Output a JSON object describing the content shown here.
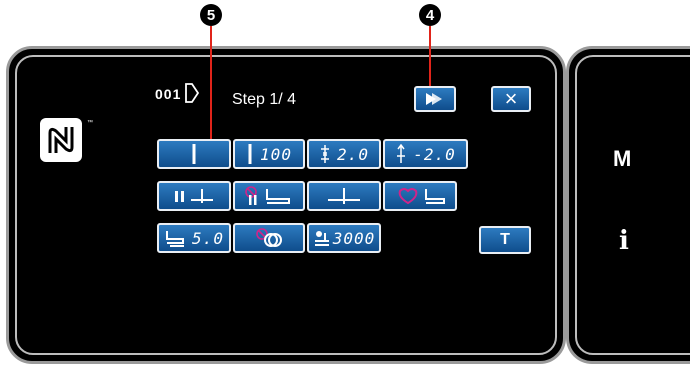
{
  "callouts": {
    "num4": "4",
    "num5": "5"
  },
  "header": {
    "program_number": "001",
    "step_label": "Step  1/ 4"
  },
  "buttons": {
    "close_glyph": "×",
    "play_glyph": "▶",
    "t_label": "T"
  },
  "grid": {
    "row1": {
      "stitch_val": "100",
      "pitch_val": "2.0",
      "reverse_val": "-2.0"
    },
    "row3": {
      "lift_val": "5.0",
      "speed_val": "3000"
    }
  },
  "side": {
    "m_label": "M",
    "i_label": "i"
  },
  "colors": {
    "button_blue": "#1a5fa5",
    "highlight_red": "#e0241a",
    "magenta": "#d0248a"
  }
}
